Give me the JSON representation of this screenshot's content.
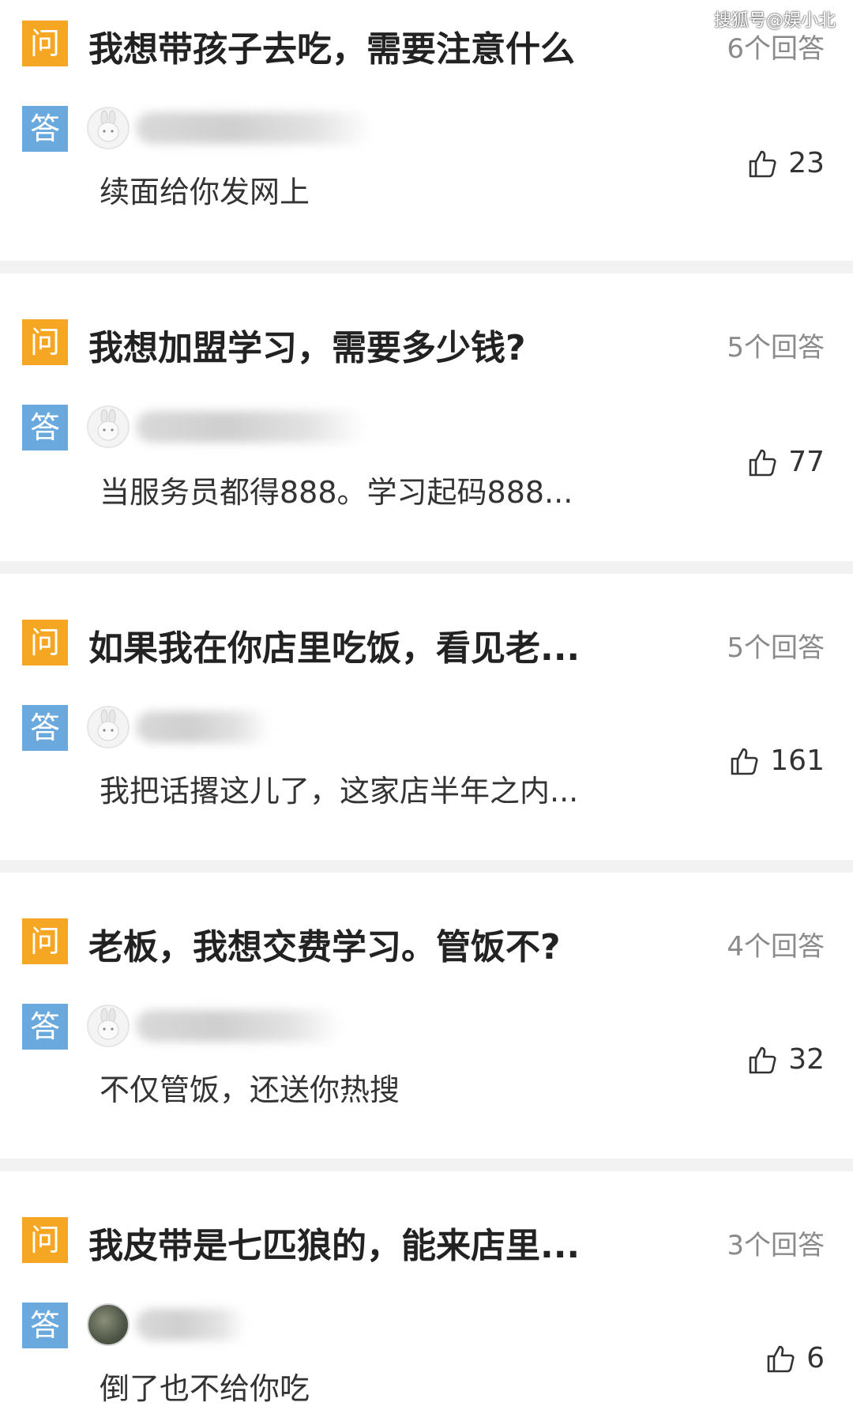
{
  "watermark": "搜狐号@娱小北",
  "badges": {
    "question": "问",
    "answer": "答"
  },
  "items": [
    {
      "question": "我想带孩子去吃，需要注意什么",
      "answer_count": "6个回答",
      "answer": "续面给你发网上",
      "likes": "23"
    },
    {
      "question": "我想加盟学习，需要多少钱?",
      "answer_count": "5个回答",
      "answer": "当服务员都得888。学习起码888...",
      "likes": "77"
    },
    {
      "question": "如果我在你店里吃饭，看见老...",
      "answer_count": "5个回答",
      "answer": "我把话撂这儿了，这家店半年之内...",
      "likes": "161"
    },
    {
      "question": "老板，我想交费学习。管饭不?",
      "answer_count": "4个回答",
      "answer": "不仅管饭，还送你热搜",
      "likes": "32"
    },
    {
      "question": "我皮带是七匹狼的，能来店里...",
      "answer_count": "3个回答",
      "answer": "倒了也不给你吃",
      "likes": "6"
    }
  ]
}
